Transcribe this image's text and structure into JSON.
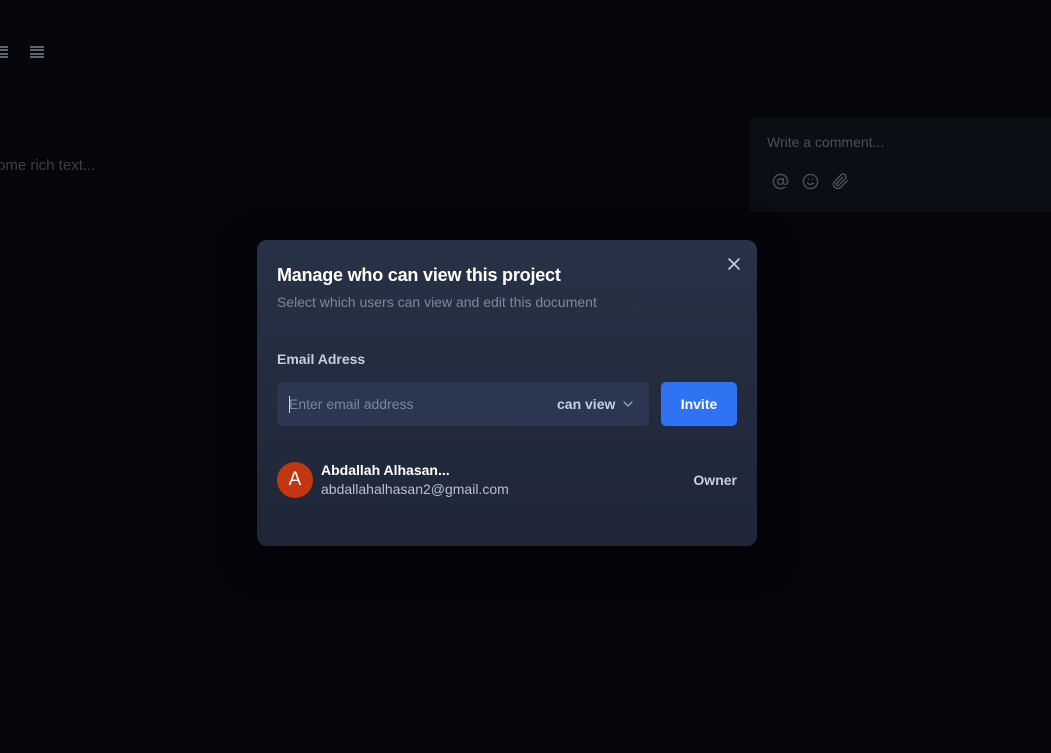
{
  "background": {
    "editor_placeholder": "ome rich text...",
    "comment_placeholder": "Write a comment...",
    "comment_tools": [
      "at-icon",
      "emoji-icon",
      "attachment-icon"
    ]
  },
  "modal": {
    "title": "Manage who can view this project",
    "subtitle": "Select which users can view and edit this document",
    "field_label": "Email Adress",
    "email_placeholder": "Enter email address",
    "email_value": "",
    "permission": "can view",
    "invite_label": "Invite",
    "members": [
      {
        "initial": "A",
        "name": "Abdallah Alhasan...",
        "email": "abdallahalhasan2@gmail.com",
        "role": "Owner",
        "avatar_color": "#c2370f"
      }
    ]
  },
  "colors": {
    "accent": "#2f73f5",
    "modal_bg": "#283246",
    "page_bg": "#05060a"
  }
}
